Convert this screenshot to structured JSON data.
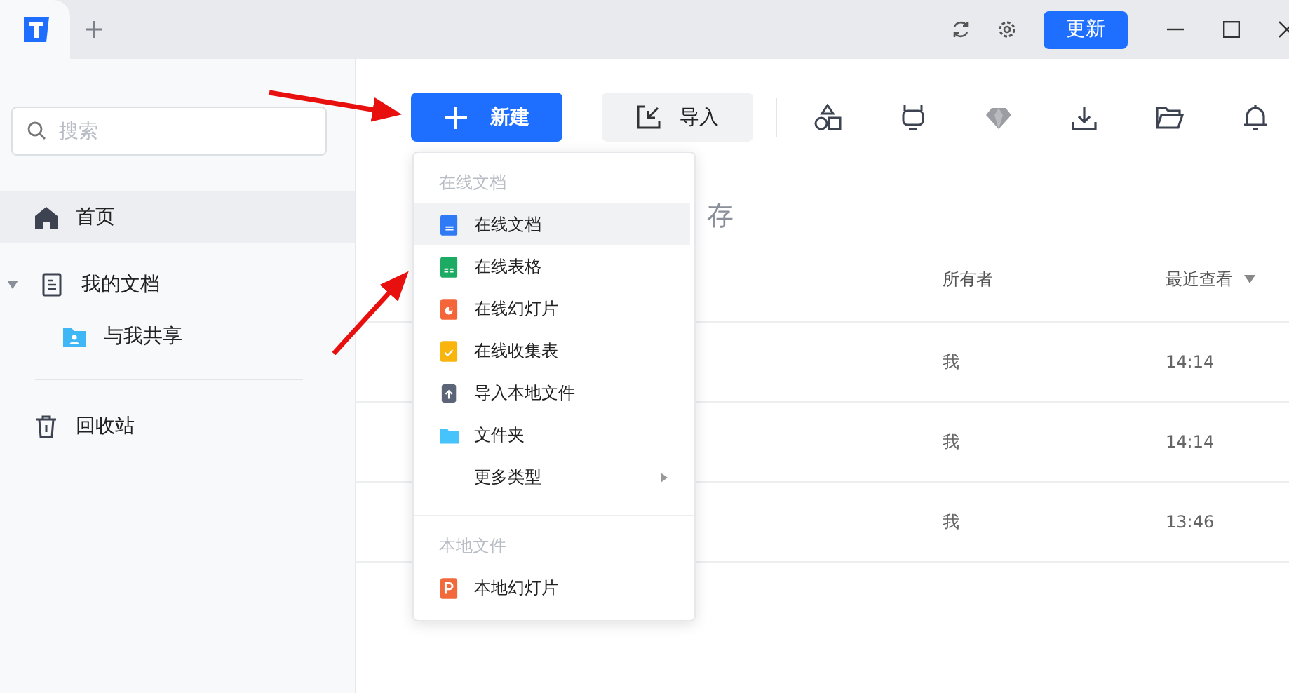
{
  "titlebar": {
    "update_button": "更新"
  },
  "sidebar": {
    "search": {
      "placeholder": "搜索"
    },
    "items": [
      {
        "label": "首页",
        "kind": "home",
        "selected": true
      },
      {
        "label": "我的文档",
        "kind": "docs",
        "selected": false,
        "expanded": true,
        "children": [
          {
            "label": "与我共享",
            "kind": "shared",
            "selected": false
          }
        ]
      },
      {
        "label": "回收站",
        "kind": "trash",
        "selected": false
      }
    ]
  },
  "toolbar": {
    "new_button": "新建",
    "import_button": "导入"
  },
  "heading": "存",
  "table": {
    "columns": [
      "所有者",
      "最近查看"
    ],
    "rows": [
      {
        "owner": "我",
        "time": "14:14"
      },
      {
        "owner": "我",
        "time": "14:14"
      },
      {
        "owner": "我",
        "time": "13:46"
      }
    ]
  },
  "new_menu": {
    "sections": [
      {
        "title": "在线文档",
        "items": [
          {
            "label": "在线文档",
            "kind": "doc",
            "hovered": true
          },
          {
            "label": "在线表格",
            "kind": "sheet",
            "hovered": false
          },
          {
            "label": "在线幻灯片",
            "kind": "slides",
            "hovered": false
          },
          {
            "label": "在线收集表",
            "kind": "form",
            "hovered": false
          },
          {
            "label": "导入本地文件",
            "kind": "import",
            "hovered": false
          },
          {
            "label": "文件夹",
            "kind": "folder",
            "hovered": false
          },
          {
            "label": "更多类型",
            "kind": "more",
            "hovered": false
          }
        ]
      },
      {
        "title": "本地文件",
        "items": [
          {
            "label": "本地幻灯片",
            "kind": "local-ppt",
            "hovered": false
          }
        ]
      }
    ]
  }
}
